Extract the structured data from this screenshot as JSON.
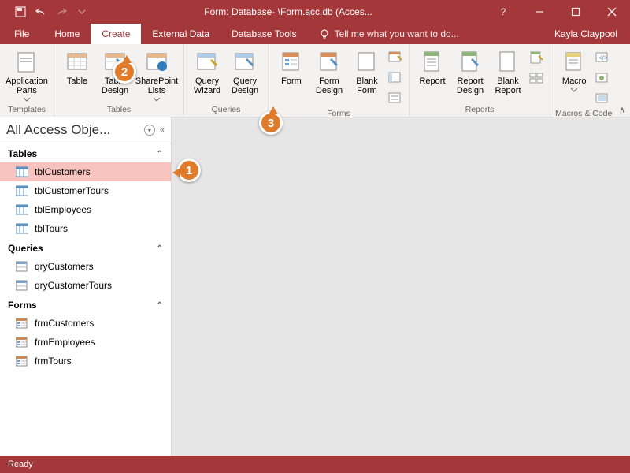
{
  "title": "Form: Database- \\Form.acc.db (Acces...",
  "user": "Kayla Claypool",
  "tabs": {
    "file": "File",
    "home": "Home",
    "create": "Create",
    "external": "External Data",
    "dbtools": "Database Tools",
    "tellme": "Tell me what you want to do..."
  },
  "ribbon": {
    "groups": {
      "templates": {
        "label": "Templates",
        "app_parts": "Application\nParts"
      },
      "tables": {
        "label": "Tables",
        "table": "Table",
        "table_design": "Table\nDesign",
        "sharepoint": "SharePoint\nLists"
      },
      "queries": {
        "label": "Queries",
        "wizard": "Query\nWizard",
        "design": "Query\nDesign"
      },
      "forms": {
        "label": "Forms",
        "form": "Form",
        "form_design": "Form\nDesign",
        "blank": "Blank\nForm"
      },
      "reports": {
        "label": "Reports",
        "report": "Report",
        "report_design": "Report\nDesign",
        "blank_report": "Blank\nReport"
      },
      "macros": {
        "label": "Macros & Code",
        "macro": "Macro"
      }
    }
  },
  "nav": {
    "title": "All Access Obje...",
    "groups": [
      {
        "name": "Tables",
        "items": [
          "tblCustomers",
          "tblCustomerTours",
          "tblEmployees",
          "tblTours"
        ],
        "kind": "table"
      },
      {
        "name": "Queries",
        "items": [
          "qryCustomers",
          "qryCustomerTours"
        ],
        "kind": "query"
      },
      {
        "name": "Forms",
        "items": [
          "frmCustomers",
          "frmEmployees",
          "frmTours"
        ],
        "kind": "form"
      }
    ],
    "selected": "tblCustomers"
  },
  "status": "Ready",
  "callouts": {
    "c1": "1",
    "c2": "2",
    "c3": "3"
  }
}
